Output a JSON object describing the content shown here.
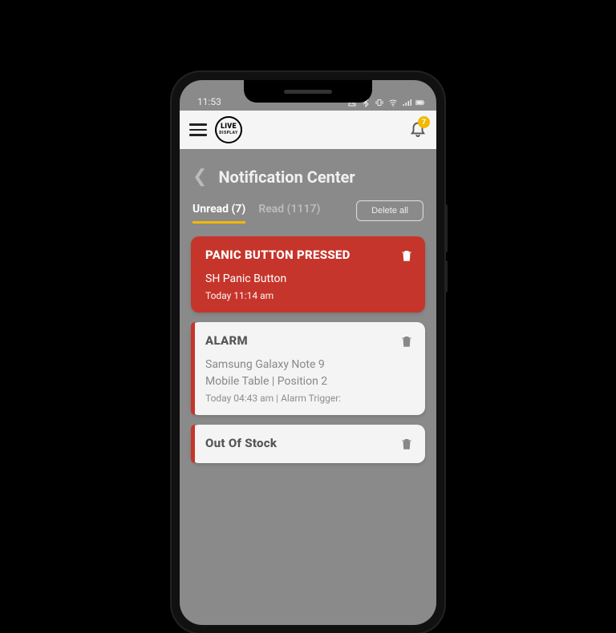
{
  "status": {
    "time": "11:53"
  },
  "logo": {
    "line1": "LIVE",
    "line2": "DISPLAY"
  },
  "notifications_badge": "7",
  "page": {
    "title": "Notification Center"
  },
  "tabs": {
    "unread": "Unread (7)",
    "read": "Read (1117)"
  },
  "actions": {
    "delete_all": "Delete all"
  },
  "cards": [
    {
      "title": "PANIC BUTTON PRESSED",
      "subtitle": "SH Panic Button",
      "meta": "Today 11:14 am"
    },
    {
      "title": "ALARM",
      "line1": "Samsung Galaxy Note 9",
      "line2": "Mobile Table  | Position 2",
      "meta": "Today 04:43 am | Alarm Trigger:"
    },
    {
      "title": "Out Of Stock"
    }
  ]
}
